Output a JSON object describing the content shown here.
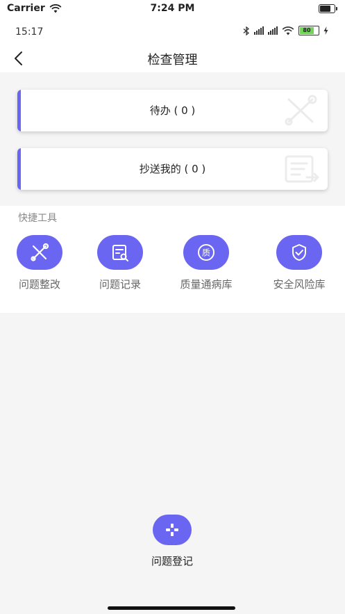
{
  "ios_status": {
    "carrier": "Carrier",
    "time": "7:24 PM"
  },
  "android_status": {
    "time": "15:17",
    "battery_level": "80",
    "icons": [
      "bluetooth-icon",
      "signal-hd-icon",
      "signal-hd-icon",
      "wifi-icon",
      "battery-icon",
      "charging-icon"
    ]
  },
  "nav": {
    "title": "检查管理",
    "back_icon": "chevron-left-icon"
  },
  "cards": [
    {
      "label": "待办 ( 0 )",
      "icon": "wrench-screwdriver-icon"
    },
    {
      "label": "抄送我的 ( 0 )",
      "icon": "document-forward-icon"
    }
  ],
  "tools": {
    "title": "快捷工具",
    "items": [
      {
        "label": "问题整改",
        "icon": "wrench-screwdriver-icon"
      },
      {
        "label": "问题记录",
        "icon": "document-search-icon"
      },
      {
        "label": "质量通病库",
        "icon": "quality-badge-icon",
        "badge_text": "质"
      },
      {
        "label": "安全风险库",
        "icon": "shield-check-icon"
      }
    ]
  },
  "fab": {
    "label": "问题登记",
    "icon": "plus-icon"
  },
  "colors": {
    "accent": "#6b66f2",
    "background": "#f5f5f5",
    "surface": "#ffffff"
  }
}
